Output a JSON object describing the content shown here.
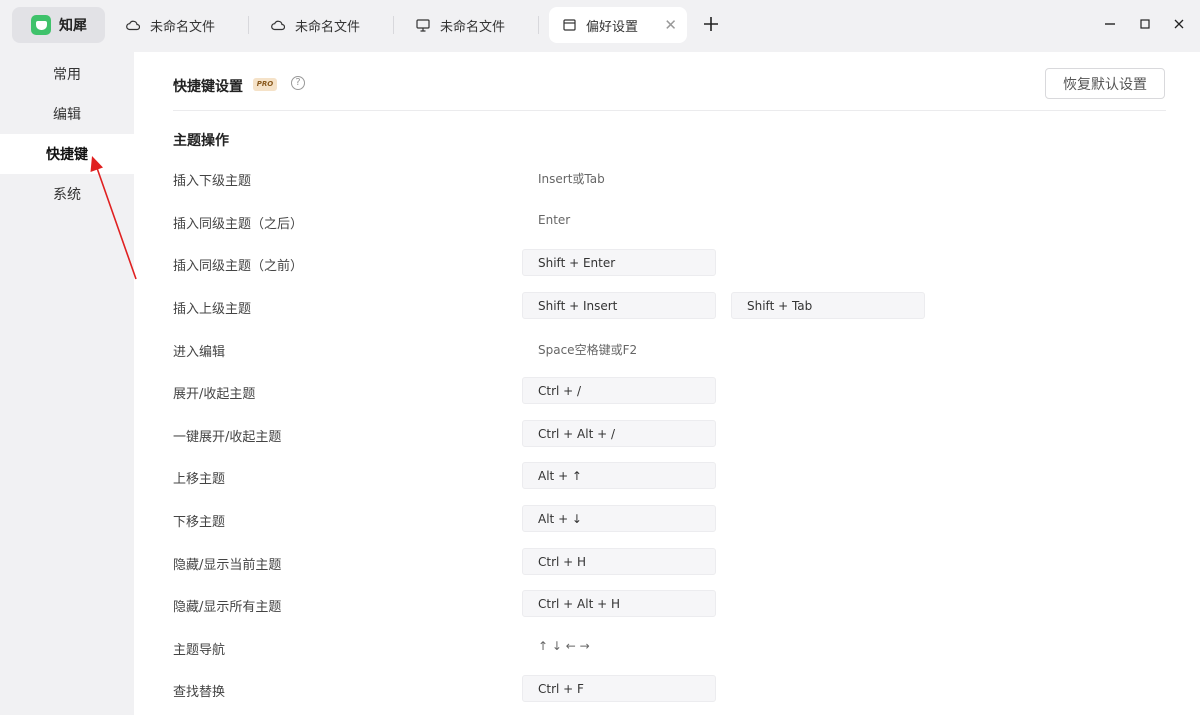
{
  "app": {
    "name": "知犀"
  },
  "tabs": [
    {
      "label": "未命名文件",
      "icon": "cloud-icon"
    },
    {
      "label": "未命名文件",
      "icon": "cloud-icon"
    },
    {
      "label": "未命名文件",
      "icon": "monitor-icon"
    },
    {
      "label": "偏好设置",
      "icon": "window-icon",
      "active": true
    }
  ],
  "sidebar": {
    "items": [
      {
        "label": "常用"
      },
      {
        "label": "编辑"
      },
      {
        "label": "快捷键",
        "active": true
      },
      {
        "label": "系统"
      }
    ]
  },
  "header": {
    "title": "快捷键设置",
    "badge": "PRO",
    "help": "?",
    "reset_label": "恢复默认设置"
  },
  "section": {
    "title": "主题操作"
  },
  "shortcuts": [
    {
      "label": "插入下级主题",
      "plain": "Insert或Tab"
    },
    {
      "label": "插入同级主题（之后）",
      "plain": "Enter"
    },
    {
      "label": "插入同级主题（之前）",
      "keys": [
        "Shift + Enter"
      ]
    },
    {
      "label": "插入上级主题",
      "keys": [
        "Shift + Insert",
        "Shift + Tab"
      ]
    },
    {
      "label": "进入编辑",
      "plain": "Space空格键或F2"
    },
    {
      "label": "展开/收起主题",
      "keys": [
        "Ctrl + /"
      ]
    },
    {
      "label": "一键展开/收起主题",
      "keys": [
        "Ctrl + Alt + /"
      ]
    },
    {
      "label": "上移主题",
      "keys": [
        "Alt + ↑"
      ]
    },
    {
      "label": "下移主题",
      "keys": [
        "Alt + ↓"
      ]
    },
    {
      "label": "隐藏/显示当前主题",
      "keys": [
        "Ctrl + H"
      ]
    },
    {
      "label": "隐藏/显示所有主题",
      "keys": [
        "Ctrl + Alt + H"
      ]
    },
    {
      "label": "主题导航",
      "plain": "↑ ↓ ← →"
    },
    {
      "label": "查找替换",
      "keys": [
        "Ctrl + F"
      ]
    }
  ],
  "colors": {
    "accent": "#3fc26b",
    "annotation": "#e02020"
  }
}
